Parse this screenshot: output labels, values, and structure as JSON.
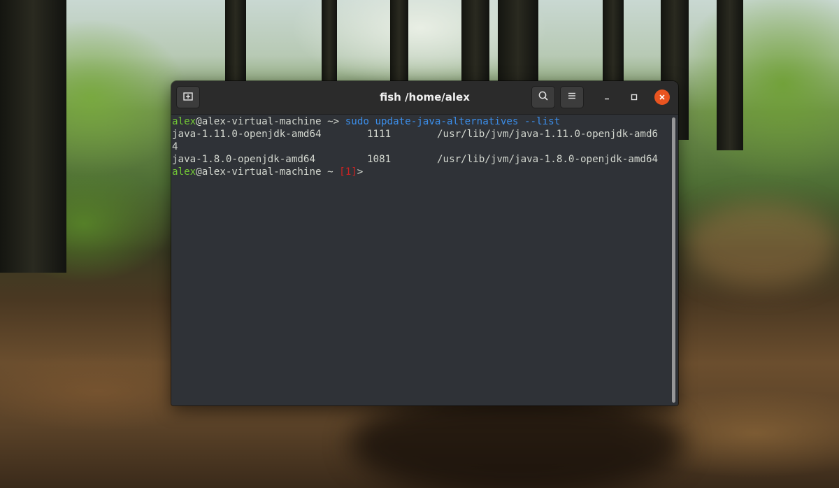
{
  "window": {
    "title": "fish /home/alex"
  },
  "icons": {
    "new_tab": "new-tab-icon",
    "search": "search-icon",
    "menu": "hamburger-menu-icon",
    "minimize": "minimize-icon",
    "maximize": "maximize-icon",
    "close": "close-icon"
  },
  "colors": {
    "close_button": "#e95420",
    "prompt_user": "#73c935",
    "command": "#3b8eea",
    "error_status": "#cc2222",
    "terminal_bg": "#2f3237"
  },
  "terminal": {
    "prompt1": {
      "user": "alex",
      "host": "@alex-virtual-machine",
      "path": " ~",
      "arrow": "> ",
      "cmd": "sudo",
      "args": " update-java-alternatives --list"
    },
    "rows": [
      {
        "name": "java-1.11.0-openjdk-amd64",
        "priority": "1111",
        "path": "/usr/lib/jvm/java-1.11.0-openjdk-amd6",
        "wrap": "4"
      },
      {
        "name": "java-1.8.0-openjdk-amd64",
        "priority": "1081",
        "path": "/usr/lib/jvm/java-1.8.0-openjdk-amd64"
      }
    ],
    "prompt2": {
      "user": "alex",
      "host": "@alex-virtual-machine",
      "path": " ~ ",
      "status": "[1]",
      "arrow": ">"
    }
  }
}
